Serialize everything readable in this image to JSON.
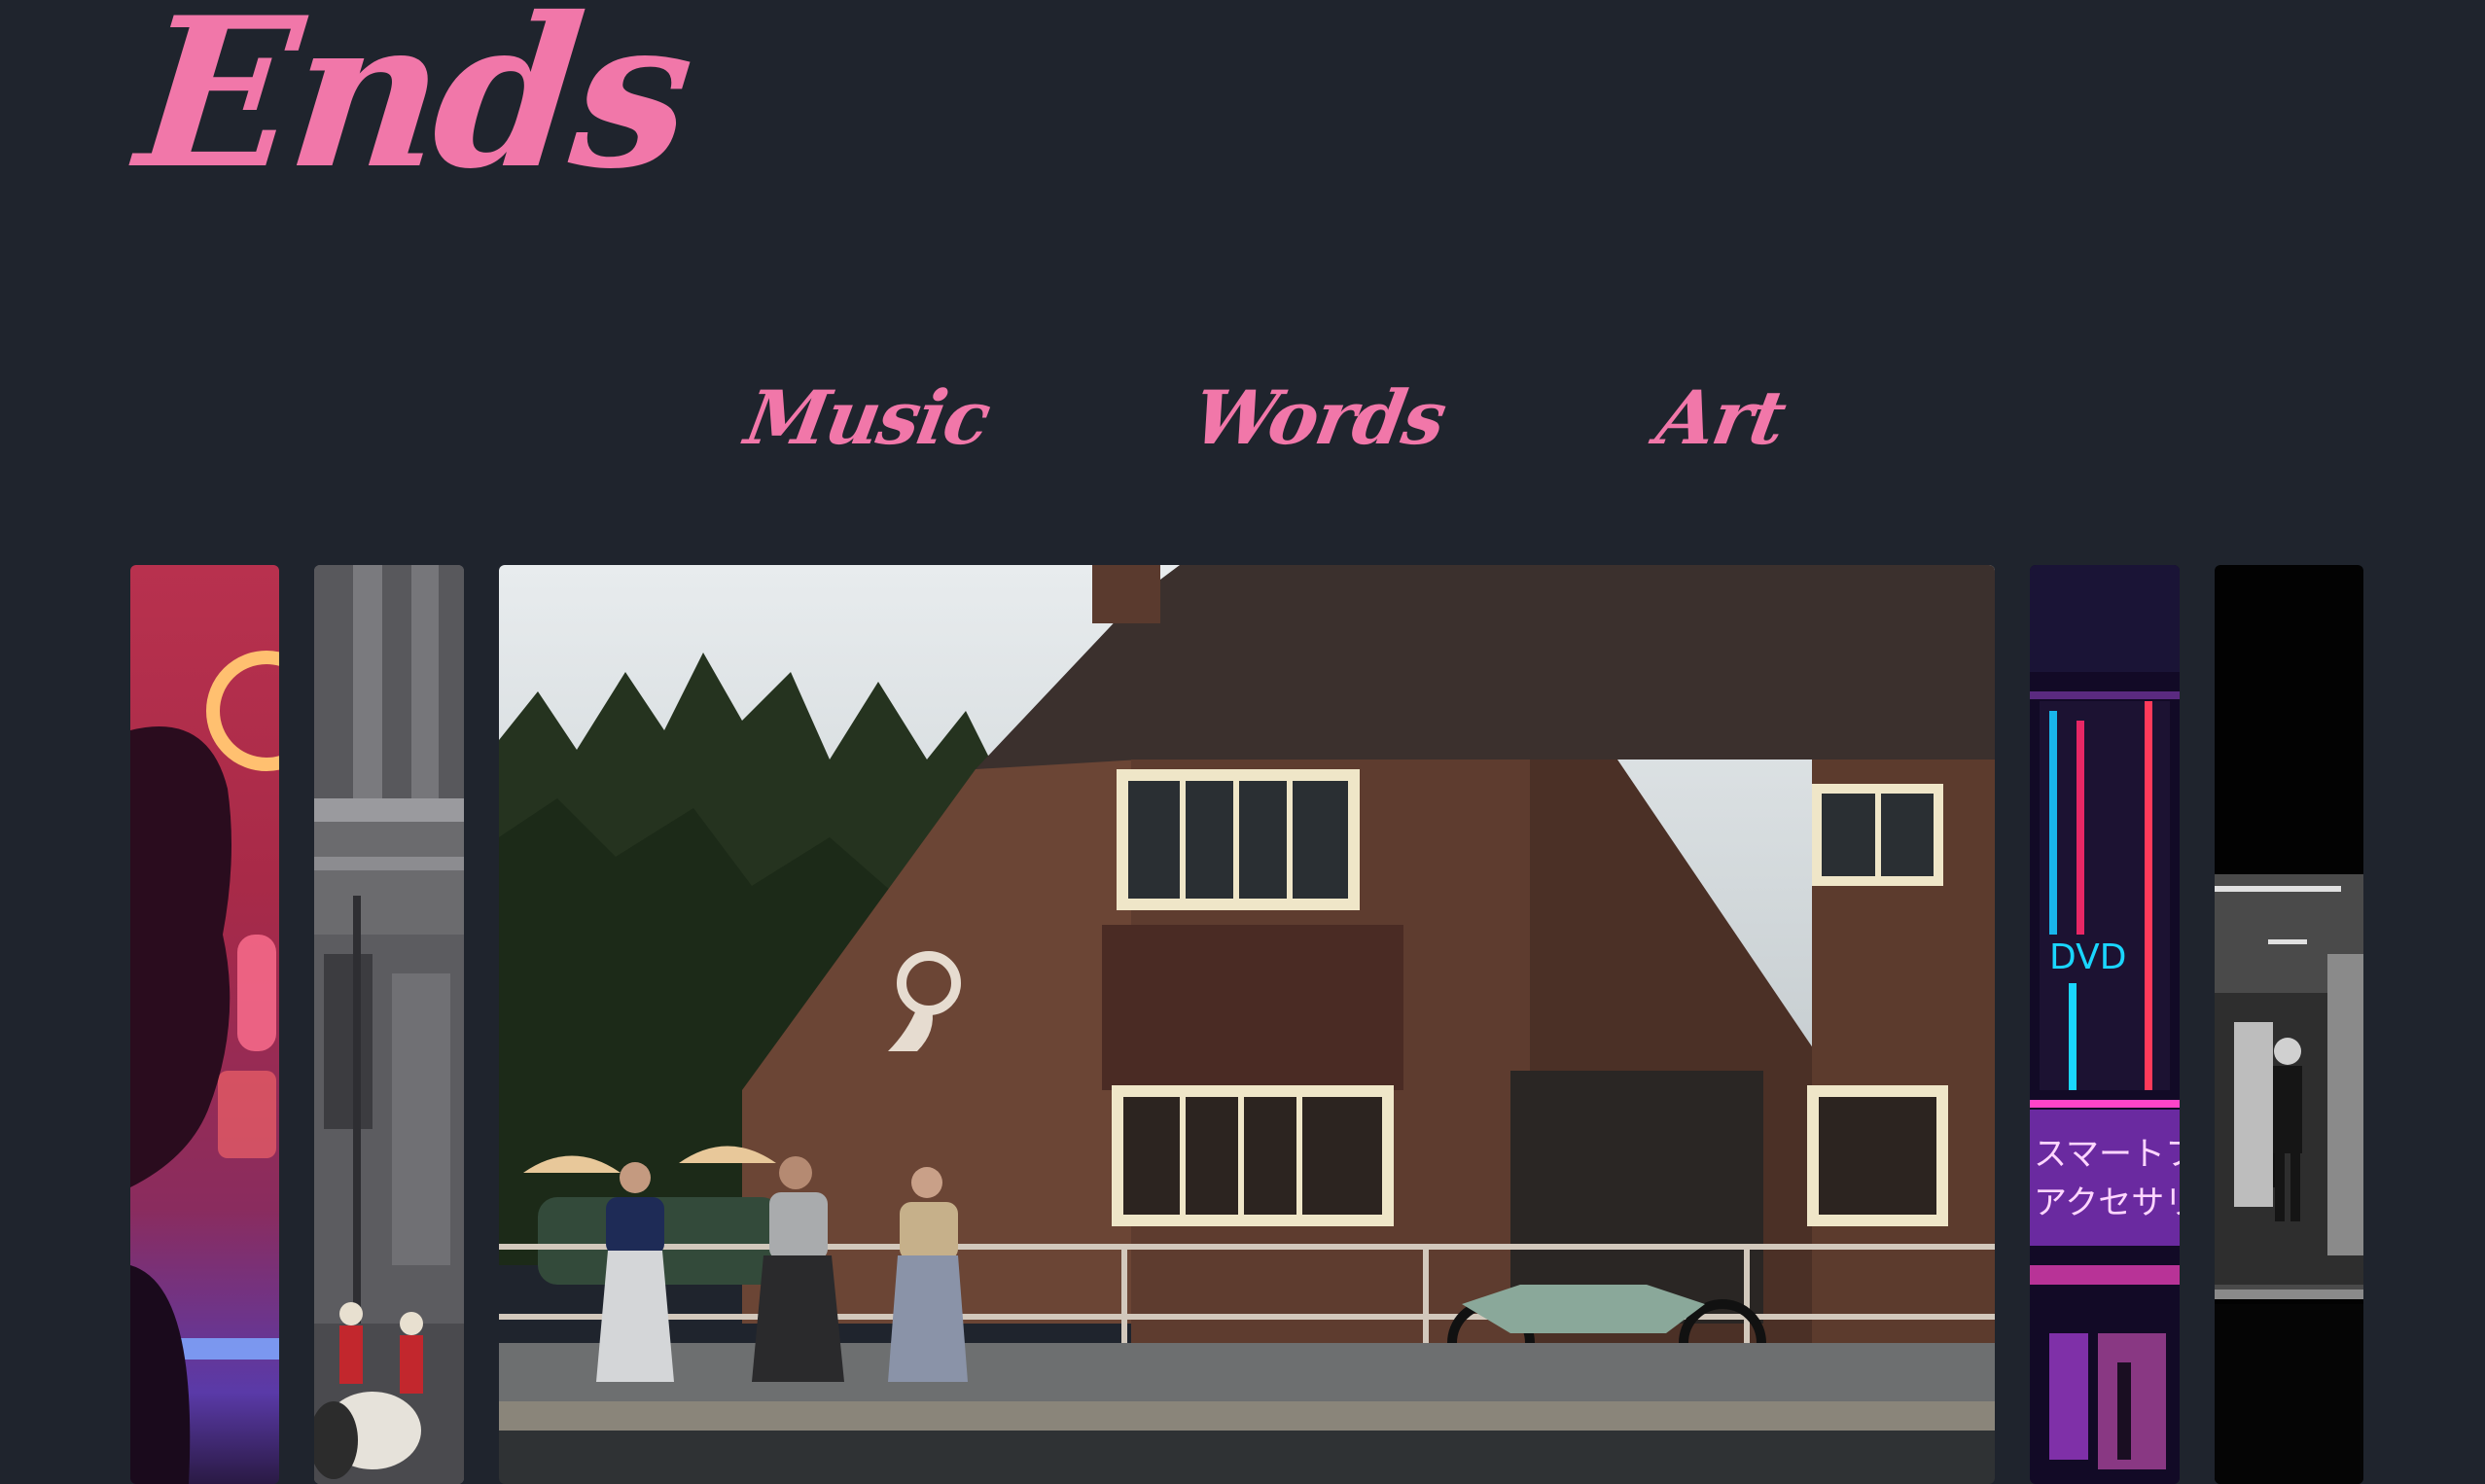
{
  "site": {
    "logo_text": "Ends",
    "accent_color": "#f177a9",
    "background_color": "#1f242d"
  },
  "nav": {
    "items": [
      {
        "label": "Music"
      },
      {
        "label": "Words"
      },
      {
        "label": "Art"
      }
    ]
  },
  "gallery": {
    "images": [
      {
        "name": "portrait-neon-photo"
      },
      {
        "name": "palace-guards-photo"
      },
      {
        "name": "pub-street-scene-photo"
      },
      {
        "name": "neon-signs-photo"
      },
      {
        "name": "subway-corridor-photo"
      }
    ],
    "signs": {
      "dvd": "DVD",
      "smartphone": "スマートフ",
      "accessory": "アクセサリ"
    }
  }
}
